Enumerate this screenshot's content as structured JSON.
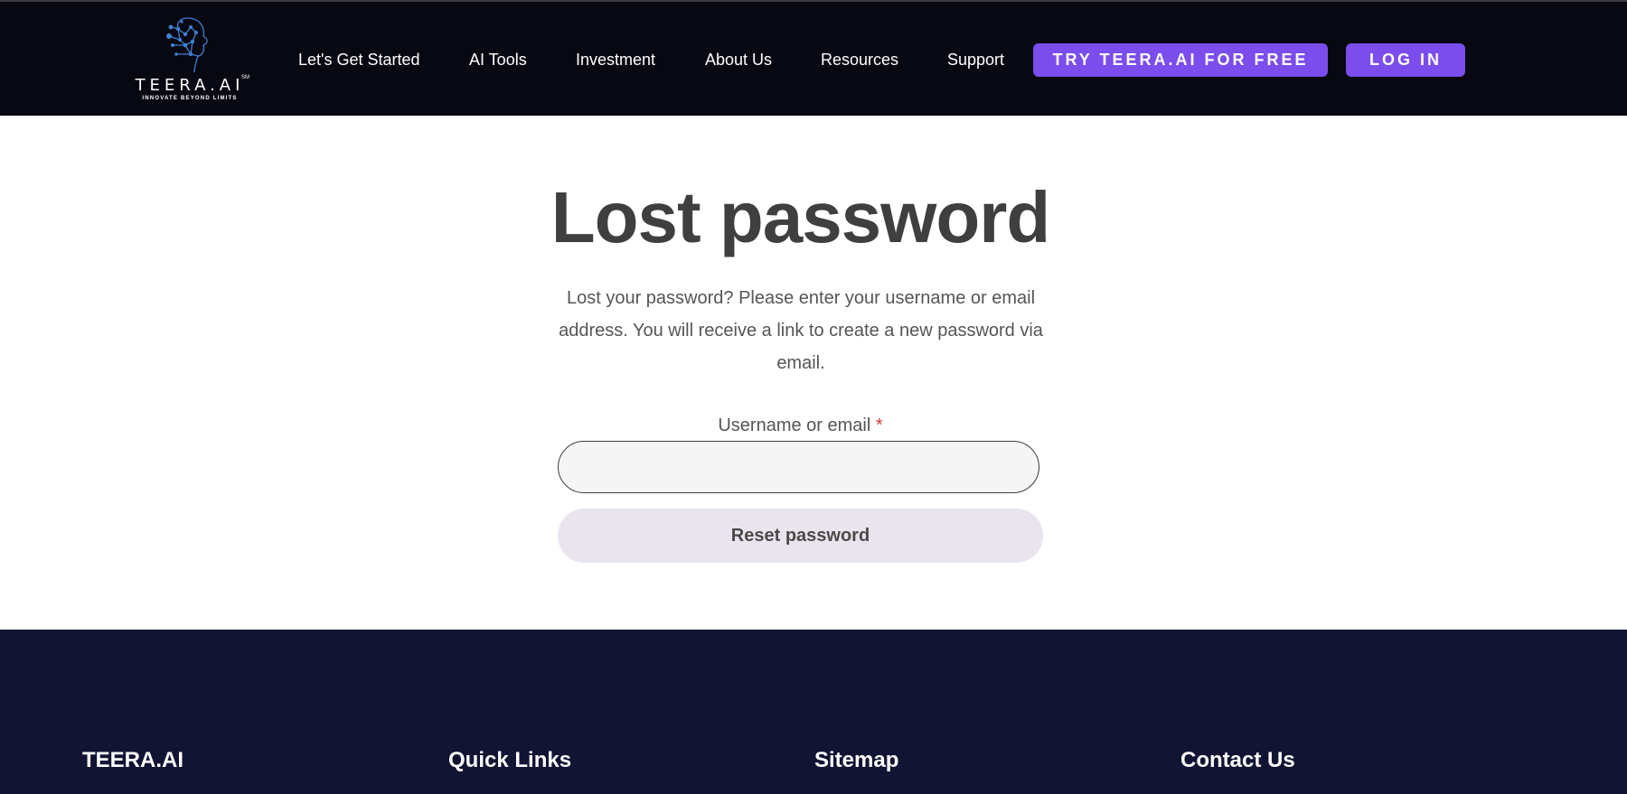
{
  "brand": {
    "name": "TEERA.AI",
    "trademark": "SM",
    "tagline": "INNOVATE BEYOND LIMITS"
  },
  "nav": {
    "items": [
      "Let's Get Started",
      "AI Tools",
      "Investment",
      "About Us",
      "Resources",
      "Support"
    ],
    "cta_label": "TRY TEERA.AI FOR FREE",
    "login_label": "LOG IN"
  },
  "main": {
    "title": "Lost password",
    "description": "Lost your password? Please enter your username or email address. You will receive a link to create a new password via email.",
    "field_label": "Username or email",
    "required_mark": "*",
    "field_value": "",
    "submit_label": "Reset password"
  },
  "footer": {
    "headings": [
      "TEERA.AI",
      "Quick Links",
      "Sitemap",
      "Contact Us"
    ]
  },
  "colors": {
    "header_bg": "#070812",
    "accent": "#7b4dec",
    "footer_bg": "#121433",
    "reset_button_bg": "#e9e4ee",
    "required": "#d23b3b"
  }
}
